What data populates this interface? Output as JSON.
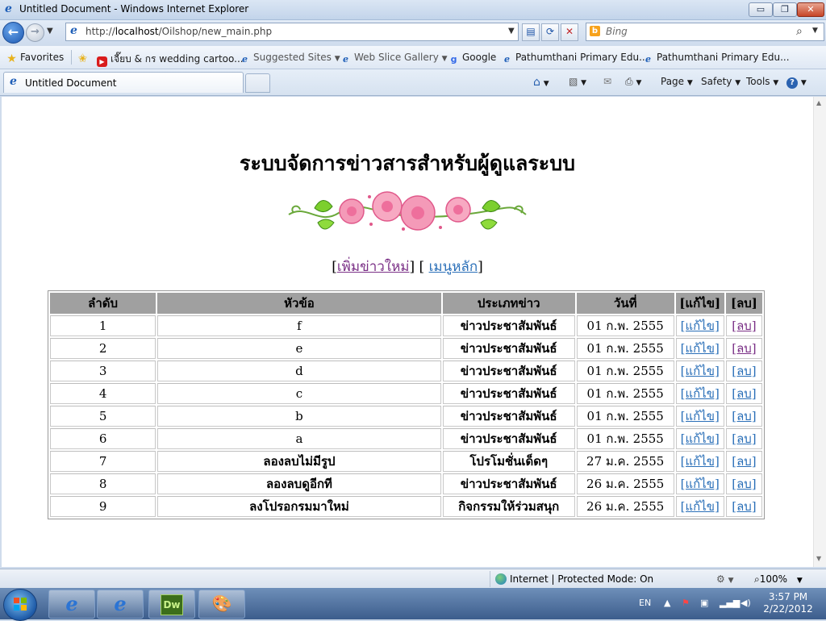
{
  "window": {
    "title": "Untitled Document - Windows Internet Explorer",
    "controls": {
      "minimize": "▭",
      "maximize": "❐",
      "close": "✕"
    }
  },
  "address_bar": {
    "url_prefix": "http://",
    "url_host": "localhost",
    "url_path": "/Oilshop/new_main.php"
  },
  "search": {
    "placeholder": "Bing"
  },
  "favorites_bar": {
    "favorites_label": "Favorites",
    "items": [
      "เจี๊ยบ & กร wedding cartoo...",
      "Suggested Sites",
      "Web Slice Gallery",
      "Google",
      "Pathumthani Primary Edu...",
      "Pathumthani Primary Edu..."
    ]
  },
  "tabs": [
    {
      "label": "Untitled Document"
    }
  ],
  "command_bar": {
    "page": "Page",
    "safety": "Safety",
    "tools": "Tools"
  },
  "page": {
    "heading": "ระบบจัดการข่าวสารสำหรับผู้ดูแลระบบ",
    "link_add": "เพิ่มข่าวใหม่",
    "link_menu": "เมนูหลัก",
    "table": {
      "headers": [
        "ลำดับ",
        "หัวข้อ",
        "ประเภทข่าว",
        "วันที่",
        "[แก้ไข]",
        "[ลบ]"
      ],
      "rows": [
        {
          "no": "1",
          "title": "f",
          "type": "ข่าวประชาสัมพันธ์",
          "date": "01 ก.พ. 2555",
          "edit": "[แก้ไข]",
          "del": "[ลบ]"
        },
        {
          "no": "2",
          "title": "e",
          "type": "ข่าวประชาสัมพันธ์",
          "date": "01 ก.พ. 2555",
          "edit": "[แก้ไข]",
          "del": "[ลบ]"
        },
        {
          "no": "3",
          "title": "d",
          "type": "ข่าวประชาสัมพันธ์",
          "date": "01 ก.พ. 2555",
          "edit": "[แก้ไข]",
          "del": "[ลบ]"
        },
        {
          "no": "4",
          "title": "c",
          "type": "ข่าวประชาสัมพันธ์",
          "date": "01 ก.พ. 2555",
          "edit": "[แก้ไข]",
          "del": "[ลบ]"
        },
        {
          "no": "5",
          "title": "b",
          "type": "ข่าวประชาสัมพันธ์",
          "date": "01 ก.พ. 2555",
          "edit": "[แก้ไข]",
          "del": "[ลบ]"
        },
        {
          "no": "6",
          "title": "a",
          "type": "ข่าวประชาสัมพันธ์",
          "date": "01 ก.พ. 2555",
          "edit": "[แก้ไข]",
          "del": "[ลบ]"
        },
        {
          "no": "7",
          "title": "ลองลบไม่มีรูป",
          "type": "โปรโมชั่นเด็ดๆ",
          "date": "27 ม.ค. 2555",
          "edit": "[แก้ไข]",
          "del": "[ลบ]"
        },
        {
          "no": "8",
          "title": "ลองลบดูอีกที",
          "type": "ข่าวประชาสัมพันธ์",
          "date": "26 ม.ค. 2555",
          "edit": "[แก้ไข]",
          "del": "[ลบ]"
        },
        {
          "no": "9",
          "title": "ลงโปรอกรมมาใหม่",
          "type": "กิจกรรมให้ร่วมสนุก",
          "date": "26 ม.ค. 2555",
          "edit": "[แก้ไข]",
          "del": "[ลบ]"
        }
      ]
    }
  },
  "status_bar": {
    "zone": "Internet | Protected Mode: On",
    "zoom": "100%"
  },
  "taskbar": {
    "lang": "EN",
    "app_dw": "Dw",
    "time": "3:57 PM",
    "date": "2/22/2012"
  },
  "colors": {
    "link": "#2a6fb8",
    "visited": "#7a2f86",
    "header_bg": "#a0a0a0"
  }
}
